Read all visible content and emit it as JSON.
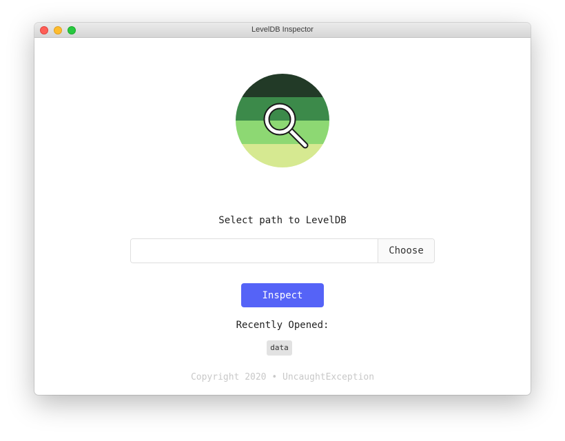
{
  "window": {
    "title": "LevelDB Inspector"
  },
  "logo": {
    "icon": "magnifier-icon",
    "colors": [
      "#223a27",
      "#3c8a4a",
      "#8dd873",
      "#d6e991"
    ]
  },
  "form": {
    "prompt": "Select path to LevelDB",
    "path_value": "",
    "path_placeholder": "",
    "choose_label": "Choose",
    "inspect_label": "Inspect",
    "accent_color": "#5563f7"
  },
  "recent": {
    "label": "Recently Opened:",
    "items": [
      "data"
    ]
  },
  "footer": {
    "copyright": "Copyright 2020 • UncaughtException"
  }
}
